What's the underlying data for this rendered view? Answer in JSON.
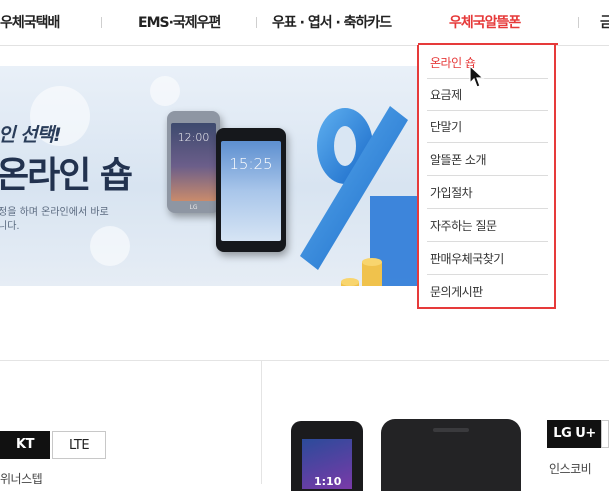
{
  "nav": {
    "items": [
      {
        "label": "우체국택배"
      },
      {
        "label": "EMS·국제우편"
      },
      {
        "label": "우표 · 엽서 · 축하카드"
      },
      {
        "label": "우체국알뜰폰"
      },
      {
        "label": "금"
      }
    ],
    "active_index": 3
  },
  "banner": {
    "subtitle": "인 선택!",
    "title": "온라인 숍",
    "desc_line1": "정을 하며 온라인에서 바로",
    "desc_line2": "니다.",
    "phone1_time": "12:00",
    "phone2_time": "15:25",
    "phone_brand": "LG"
  },
  "dropdown": {
    "items": [
      {
        "label": "온라인 숍"
      },
      {
        "label": "요금제"
      },
      {
        "label": "단말기"
      },
      {
        "label": "알뜰폰 소개"
      },
      {
        "label": "가입절차"
      },
      {
        "label": "자주하는 질문"
      },
      {
        "label": "판매우체국찾기"
      },
      {
        "label": "문의게시판"
      }
    ],
    "active_index": 0
  },
  "products": {
    "left": {
      "carrier": "KT",
      "network": "LTE",
      "name": "위너스텝"
    },
    "right": {
      "carrier": "LG U+",
      "name": "인스코비"
    },
    "flip_time": "1:10"
  },
  "colors": {
    "accent": "#e63a3a",
    "dark": "#111111",
    "border": "#c8c8c8"
  }
}
